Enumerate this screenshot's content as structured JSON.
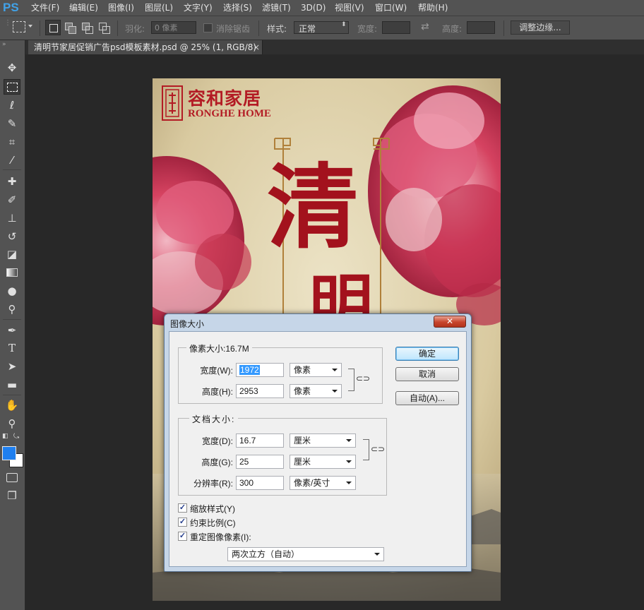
{
  "app": {
    "logo": "PS"
  },
  "menu": [
    "文件(F)",
    "编辑(E)",
    "图像(I)",
    "图层(L)",
    "文字(Y)",
    "选择(S)",
    "滤镜(T)",
    "3D(D)",
    "视图(V)",
    "窗口(W)",
    "帮助(H)"
  ],
  "options": {
    "feather_label": "羽化:",
    "feather_value": "0 像素",
    "antialias_label": "消除锯齿",
    "style_label": "样式:",
    "style_value": "正常",
    "width_label": "宽度:",
    "height_label": "高度:",
    "refine_button": "调整边缘..."
  },
  "document_tab": {
    "title": "清明节家居促销广告psd模板素材.psd @ 25% (1, RGB/8)",
    "close": "×"
  },
  "tools": [
    "move-icon",
    "marquee-icon",
    "lasso-icon",
    "quick-select-icon",
    "crop-icon",
    "eyedropper-icon",
    "healing-brush-icon",
    "brush-icon",
    "clone-stamp-icon",
    "history-brush-icon",
    "eraser-icon",
    "gradient-icon",
    "blur-icon",
    "dodge-icon",
    "pen-icon",
    "type-icon",
    "path-select-icon",
    "rectangle-icon",
    "hand-icon",
    "zoom-icon"
  ],
  "colors": {
    "foreground": "#1e7ff0",
    "background": "#ffffff",
    "brand_red": "#b31b24",
    "flower": "#d23a5a"
  },
  "poster": {
    "brand_cn": "容和家居",
    "brand_en": "RONGHE HOME",
    "title_char_1": "清",
    "title_char_2": "明"
  },
  "dialog": {
    "title": "图像大小",
    "close": "✕",
    "pixel_group": "像素大小:16.7M",
    "px_width_label": "宽度(W):",
    "px_width_value": "1972",
    "px_width_unit": "像素",
    "px_height_label": "高度(H):",
    "px_height_value": "2953",
    "px_height_unit": "像素",
    "doc_group": "文档大小:",
    "doc_width_label": "宽度(D):",
    "doc_width_value": "16.7",
    "doc_width_unit": "厘米",
    "doc_height_label": "高度(G):",
    "doc_height_value": "25",
    "doc_height_unit": "厘米",
    "resolution_label": "分辨率(R):",
    "resolution_value": "300",
    "resolution_unit": "像素/英寸",
    "scale_styles": "缩放样式(Y)",
    "constrain": "约束比例(C)",
    "resample": "重定图像像素(I):",
    "resample_method": "两次立方（自动）",
    "ok": "确定",
    "cancel": "取消",
    "auto": "自动(A)..."
  }
}
